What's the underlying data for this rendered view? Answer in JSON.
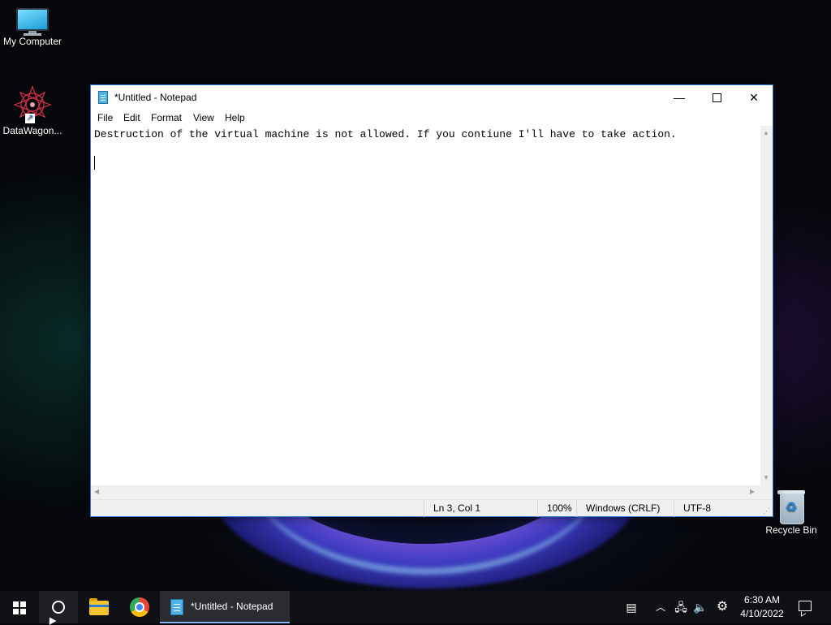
{
  "desktop": {
    "icons": [
      {
        "label": "My Computer"
      },
      {
        "label": "DataWagon..."
      },
      {
        "label": "Recycle Bin"
      }
    ]
  },
  "notepad": {
    "title": "*Untitled - Notepad",
    "menu": [
      "File",
      "Edit",
      "Format",
      "View",
      "Help"
    ],
    "content_lines": [
      "Destruction of the virtual machine is not allowed. If you contiune I'll have to take action.",
      "",
      ""
    ],
    "status": {
      "position": "Ln 3, Col 1",
      "zoom": "100%",
      "line_ending": "Windows (CRLF)",
      "encoding": "UTF-8"
    }
  },
  "taskbar": {
    "active_app_label": "*Untitled - Notepad",
    "clock_time": "6:30 AM",
    "clock_date": "4/10/2022"
  },
  "colors": {
    "accent": "#2b7bd6",
    "taskbar_bg": "#101114"
  }
}
